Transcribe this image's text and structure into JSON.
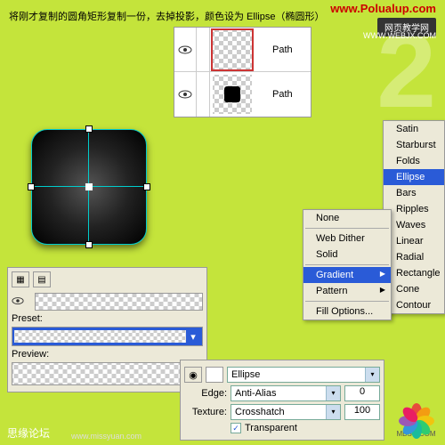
{
  "instruction": "将刚才复制的圆角矩形复制一份，去掉投影，颜色设为 Ellipse（椭圆形）",
  "watermarks": {
    "top": "www.Polualup.com",
    "web_label": "网页教学网",
    "web_url": "WWW.WEBJX.COM"
  },
  "layers": [
    {
      "label": "Path",
      "selected": true,
      "has_shape": false
    },
    {
      "label": "Path",
      "selected": false,
      "has_shape": true
    }
  ],
  "gradient_types": [
    "Satin",
    "Starburst",
    "Folds",
    "Ellipse",
    "Bars",
    "Ripples",
    "Waves",
    "Linear",
    "Radial",
    "Rectangle",
    "Cone",
    "Contour"
  ],
  "gradient_selected": "Ellipse",
  "fill_menu": {
    "none": "None",
    "webdither": "Web Dither",
    "solid": "Solid",
    "gradient": "Gradient",
    "pattern": "Pattern",
    "options": "Fill Options..."
  },
  "panel": {
    "preset_label": "Preset:",
    "preview_label": "Preview:"
  },
  "props": {
    "fill_value": "Ellipse",
    "edge_label": "Edge:",
    "edge_value": "Anti-Alias",
    "texture_label": "Texture:",
    "texture_value": "Crosshatch",
    "texture_num": "100",
    "transparent_label": "Transparent"
  },
  "footer": {
    "main": "思缘论坛",
    "sub": "www.missyuan.com",
    "logo": "MBSU.COM"
  }
}
